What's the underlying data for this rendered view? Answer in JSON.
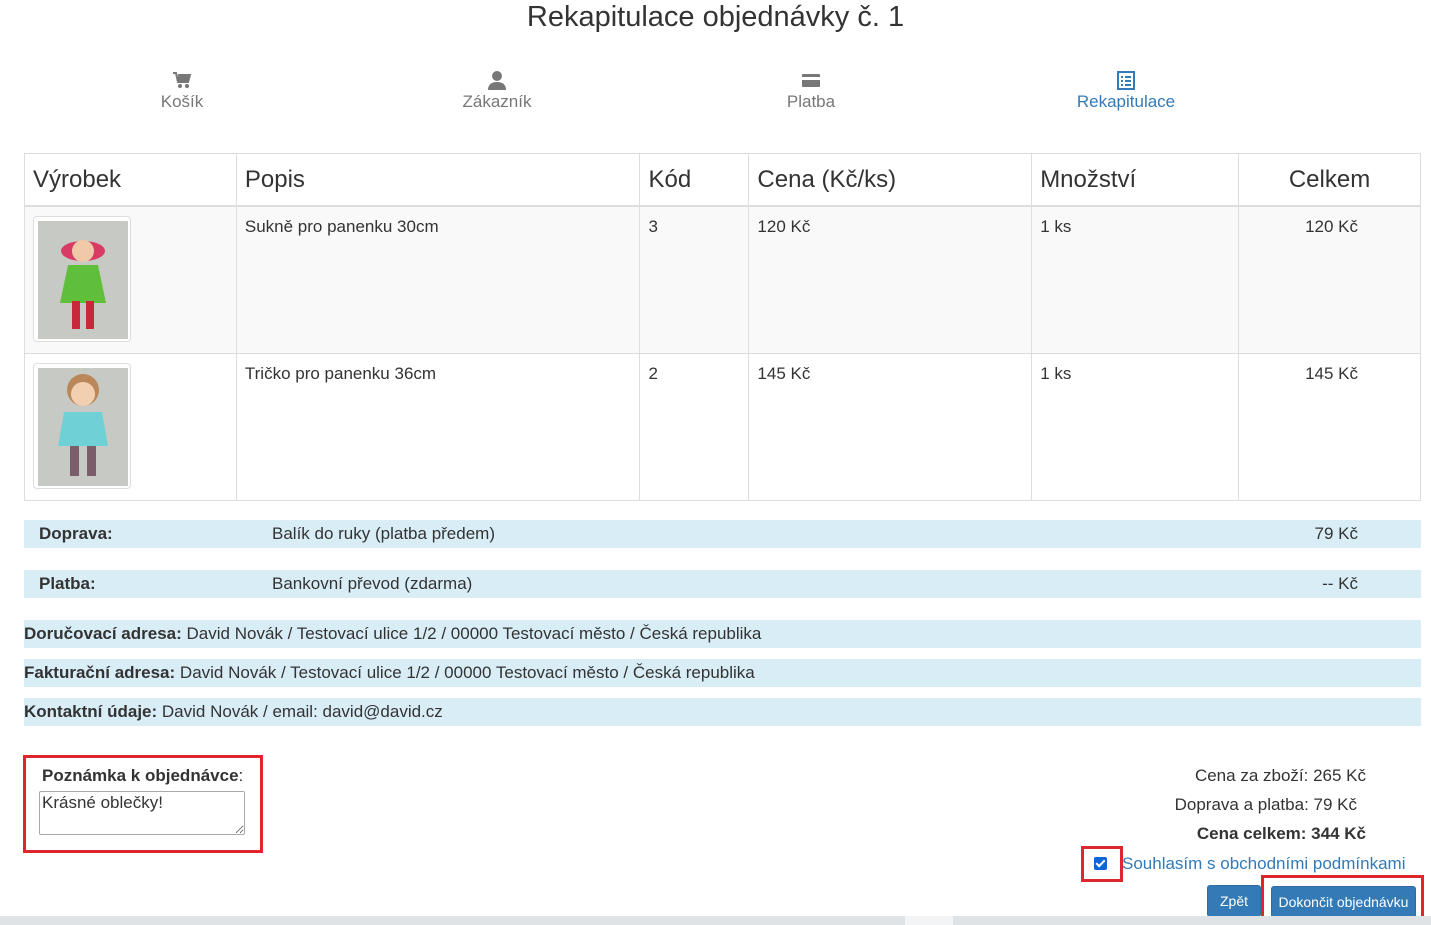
{
  "page": {
    "title": "Rekapitulace objednávky č. 1"
  },
  "steps": [
    {
      "label": "Košík",
      "icon": "cart-icon",
      "active": false
    },
    {
      "label": "Zákazník",
      "icon": "user-icon",
      "active": false
    },
    {
      "label": "Platba",
      "icon": "credit-card-icon",
      "active": false
    },
    {
      "label": "Rekapitulace",
      "icon": "list-icon",
      "active": true
    }
  ],
  "table": {
    "headers": [
      "Výrobek",
      "Popis",
      "Kód",
      "Cena (Kč/ks)",
      "Množství",
      "Celkem"
    ],
    "rows": [
      {
        "description": "Sukně pro panenku 30cm",
        "code": "3",
        "price": "120 Kč",
        "quantity": "1 ks",
        "total": "120 Kč"
      },
      {
        "description": "Tričko pro panenku 36cm",
        "code": "2",
        "price": "145 Kč",
        "quantity": "1 ks",
        "total": "145 Kč"
      }
    ]
  },
  "shipping": {
    "label": "Doprava:",
    "value": "Balík do ruky (platba předem)",
    "price": "79 Kč"
  },
  "payment": {
    "label": "Platba:",
    "value": "Bankovní převod (zdarma)",
    "price": "-- Kč"
  },
  "delivery_address": {
    "label": "Doručovací adresa:",
    "value": "David Novák / Testovací ulice 1/2 / 00000 Testovací město / Česká republika"
  },
  "billing_address": {
    "label": "Fakturační adresa:",
    "value": "David Novák / Testovací ulice 1/2 / 00000 Testovací město / Česká republika"
  },
  "contact": {
    "label": "Kontaktní údaje:",
    "value": "David Novák / email: david@david.cz"
  },
  "note": {
    "label": "Poznámka k objednávce",
    "colon": ":",
    "value": "Krásné oblečky!"
  },
  "summary": {
    "goods": "Cena za zboží: 265 Kč",
    "shipping_payment": "Doprava a platba: 79 Kč",
    "total": "Cena celkem: 344 Kč"
  },
  "terms": {
    "label": "Souhlasím s obchodními podmínkami",
    "checked": true
  },
  "buttons": {
    "back": "Zpět",
    "finish": "Dokončit objednávku"
  },
  "colors": {
    "accent": "#337ab7",
    "info_bg": "#d9edf7",
    "highlight": "#e0262d"
  }
}
